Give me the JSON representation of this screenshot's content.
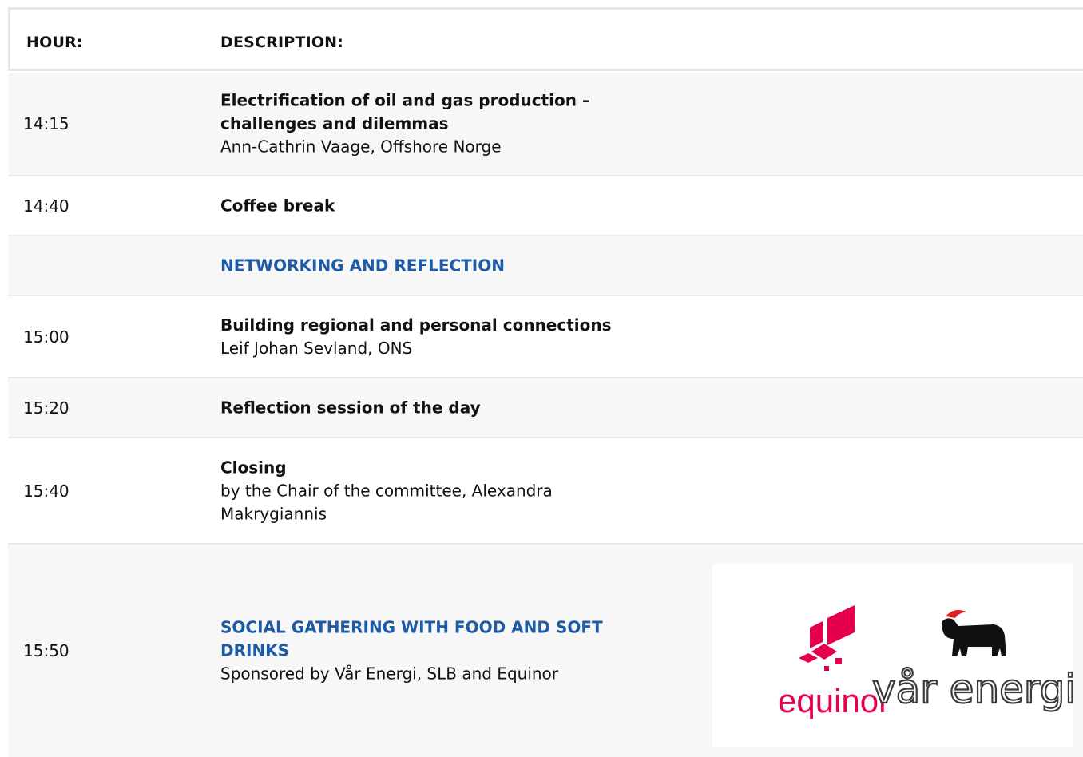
{
  "header": {
    "col_hour": "HOUR:",
    "col_description": "DESCRIPTION:"
  },
  "rows": [
    {
      "hour": "14:15",
      "title": "Electrification of oil and gas production – challenges and dilemmas",
      "subtitle": "Ann-Cathrin Vaage, Offshore Norge"
    },
    {
      "hour": "14:40",
      "title": "Coffee break"
    },
    {
      "section": "NETWORKING AND REFLECTION"
    },
    {
      "hour": "15:00",
      "title": "Building regional and personal connections",
      "subtitle": "Leif Johan Sevland, ONS"
    },
    {
      "hour": "15:20",
      "title": "Reflection session of the day"
    },
    {
      "hour": "15:40",
      "title": "Closing",
      "subtitle": "by the Chair of the committee, Alexandra Makrygiannis"
    },
    {
      "hour": "15:50",
      "title": "SOCIAL GATHERING WITH FOOD AND SOFT DRINKS",
      "subtitle": "Sponsored by Vår Energi, SLB and Equinor"
    }
  ],
  "logos": {
    "equinor": "equinor",
    "var_energi": "vår energi"
  },
  "colors": {
    "accent_blue": "#1d5ba6",
    "equinor_red": "#e4004f",
    "row_alt": "#f7f7f7"
  }
}
